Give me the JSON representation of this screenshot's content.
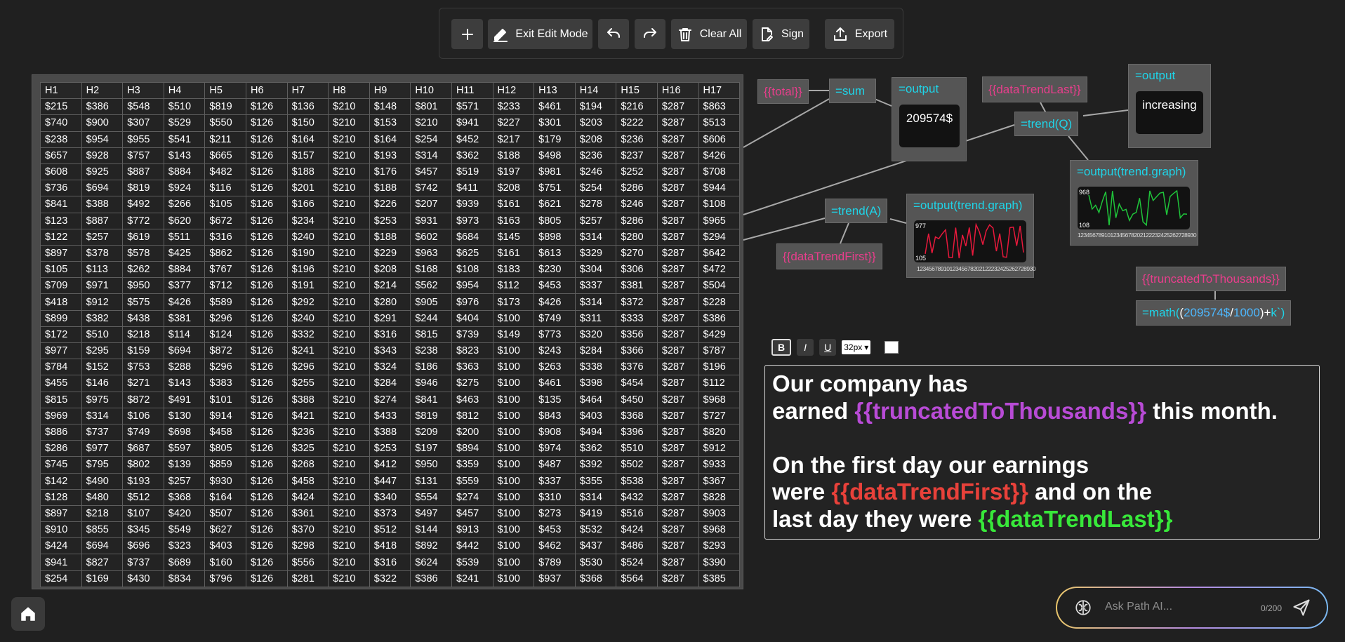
{
  "toolbar": {
    "add_label": "",
    "exit_edit_label": "Exit Edit Mode",
    "clear_all_label": "Clear All",
    "sign_label": "Sign",
    "export_label": "Export"
  },
  "sheet": {
    "headers": [
      "H1",
      "H2",
      "H3",
      "H4",
      "H5",
      "H6",
      "H7",
      "H8",
      "H9",
      "H10",
      "H11",
      "H12",
      "H13",
      "H14",
      "H15",
      "H16",
      "H17"
    ],
    "rows": [
      [
        "$215",
        "$386",
        "$548",
        "$510",
        "$819",
        "$126",
        "$136",
        "$210",
        "$148",
        "$801",
        "$571",
        "$233",
        "$461",
        "$194",
        "$216",
        "$287",
        "$863"
      ],
      [
        "$740",
        "$900",
        "$307",
        "$529",
        "$550",
        "$126",
        "$150",
        "$210",
        "$153",
        "$210",
        "$941",
        "$227",
        "$301",
        "$203",
        "$222",
        "$287",
        "$513"
      ],
      [
        "$238",
        "$954",
        "$955",
        "$541",
        "$211",
        "$126",
        "$164",
        "$210",
        "$164",
        "$254",
        "$452",
        "$217",
        "$179",
        "$208",
        "$236",
        "$287",
        "$606"
      ],
      [
        "$657",
        "$928",
        "$757",
        "$143",
        "$665",
        "$126",
        "$157",
        "$210",
        "$193",
        "$314",
        "$362",
        "$188",
        "$498",
        "$236",
        "$237",
        "$287",
        "$426"
      ],
      [
        "$608",
        "$925",
        "$887",
        "$884",
        "$482",
        "$126",
        "$188",
        "$210",
        "$176",
        "$457",
        "$519",
        "$197",
        "$981",
        "$246",
        "$252",
        "$287",
        "$708"
      ],
      [
        "$736",
        "$694",
        "$819",
        "$924",
        "$116",
        "$126",
        "$201",
        "$210",
        "$188",
        "$742",
        "$411",
        "$208",
        "$751",
        "$254",
        "$286",
        "$287",
        "$944"
      ],
      [
        "$841",
        "$388",
        "$492",
        "$266",
        "$105",
        "$126",
        "$166",
        "$210",
        "$226",
        "$207",
        "$939",
        "$161",
        "$621",
        "$278",
        "$246",
        "$287",
        "$108"
      ],
      [
        "$123",
        "$887",
        "$772",
        "$620",
        "$672",
        "$126",
        "$234",
        "$210",
        "$253",
        "$931",
        "$973",
        "$163",
        "$805",
        "$257",
        "$286",
        "$287",
        "$965"
      ],
      [
        "$122",
        "$257",
        "$619",
        "$511",
        "$316",
        "$126",
        "$240",
        "$210",
        "$188",
        "$602",
        "$684",
        "$145",
        "$898",
        "$314",
        "$280",
        "$287",
        "$294"
      ],
      [
        "$897",
        "$378",
        "$578",
        "$425",
        "$862",
        "$126",
        "$190",
        "$210",
        "$229",
        "$963",
        "$625",
        "$161",
        "$613",
        "$329",
        "$270",
        "$287",
        "$642"
      ],
      [
        "$105",
        "$113",
        "$262",
        "$884",
        "$767",
        "$126",
        "$196",
        "$210",
        "$208",
        "$168",
        "$108",
        "$183",
        "$230",
        "$304",
        "$306",
        "$287",
        "$472"
      ],
      [
        "$709",
        "$971",
        "$950",
        "$377",
        "$712",
        "$126",
        "$191",
        "$210",
        "$214",
        "$562",
        "$954",
        "$112",
        "$453",
        "$337",
        "$381",
        "$287",
        "$504"
      ],
      [
        "$418",
        "$912",
        "$575",
        "$426",
        "$589",
        "$126",
        "$292",
        "$210",
        "$280",
        "$905",
        "$976",
        "$173",
        "$426",
        "$314",
        "$372",
        "$287",
        "$228"
      ],
      [
        "$899",
        "$382",
        "$438",
        "$381",
        "$296",
        "$126",
        "$240",
        "$210",
        "$291",
        "$244",
        "$404",
        "$100",
        "$749",
        "$311",
        "$333",
        "$287",
        "$386"
      ],
      [
        "$172",
        "$510",
        "$218",
        "$114",
        "$124",
        "$126",
        "$332",
        "$210",
        "$316",
        "$815",
        "$739",
        "$149",
        "$773",
        "$320",
        "$356",
        "$287",
        "$429"
      ],
      [
        "$977",
        "$295",
        "$159",
        "$694",
        "$872",
        "$126",
        "$241",
        "$210",
        "$343",
        "$238",
        "$823",
        "$100",
        "$243",
        "$284",
        "$366",
        "$287",
        "$787"
      ],
      [
        "$784",
        "$152",
        "$753",
        "$288",
        "$296",
        "$126",
        "$296",
        "$210",
        "$324",
        "$186",
        "$363",
        "$100",
        "$263",
        "$338",
        "$376",
        "$287",
        "$196"
      ],
      [
        "$455",
        "$146",
        "$271",
        "$143",
        "$383",
        "$126",
        "$255",
        "$210",
        "$284",
        "$946",
        "$275",
        "$100",
        "$461",
        "$398",
        "$454",
        "$287",
        "$112"
      ],
      [
        "$815",
        "$975",
        "$872",
        "$491",
        "$101",
        "$126",
        "$388",
        "$210",
        "$274",
        "$841",
        "$463",
        "$100",
        "$135",
        "$464",
        "$450",
        "$287",
        "$968"
      ],
      [
        "$969",
        "$314",
        "$106",
        "$130",
        "$914",
        "$126",
        "$421",
        "$210",
        "$433",
        "$819",
        "$812",
        "$100",
        "$843",
        "$403",
        "$368",
        "$287",
        "$727"
      ],
      [
        "$886",
        "$737",
        "$749",
        "$698",
        "$458",
        "$126",
        "$236",
        "$210",
        "$388",
        "$209",
        "$200",
        "$100",
        "$908",
        "$494",
        "$396",
        "$287",
        "$820"
      ],
      [
        "$286",
        "$977",
        "$687",
        "$597",
        "$805",
        "$126",
        "$325",
        "$210",
        "$253",
        "$197",
        "$894",
        "$100",
        "$974",
        "$362",
        "$510",
        "$287",
        "$912"
      ],
      [
        "$745",
        "$795",
        "$802",
        "$139",
        "$859",
        "$126",
        "$268",
        "$210",
        "$412",
        "$950",
        "$359",
        "$100",
        "$487",
        "$392",
        "$502",
        "$287",
        "$933"
      ],
      [
        "$142",
        "$490",
        "$193",
        "$257",
        "$930",
        "$126",
        "$458",
        "$210",
        "$447",
        "$131",
        "$559",
        "$100",
        "$337",
        "$355",
        "$538",
        "$287",
        "$367"
      ],
      [
        "$128",
        "$480",
        "$512",
        "$368",
        "$164",
        "$126",
        "$424",
        "$210",
        "$340",
        "$554",
        "$274",
        "$100",
        "$310",
        "$314",
        "$432",
        "$287",
        "$828"
      ],
      [
        "$897",
        "$218",
        "$107",
        "$420",
        "$507",
        "$126",
        "$361",
        "$210",
        "$373",
        "$497",
        "$457",
        "$100",
        "$273",
        "$419",
        "$516",
        "$287",
        "$903"
      ],
      [
        "$910",
        "$855",
        "$345",
        "$549",
        "$627",
        "$126",
        "$370",
        "$210",
        "$512",
        "$144",
        "$913",
        "$100",
        "$453",
        "$532",
        "$424",
        "$287",
        "$968"
      ],
      [
        "$424",
        "$694",
        "$696",
        "$323",
        "$403",
        "$126",
        "$298",
        "$210",
        "$418",
        "$892",
        "$442",
        "$100",
        "$462",
        "$437",
        "$486",
        "$287",
        "$293"
      ],
      [
        "$941",
        "$827",
        "$737",
        "$689",
        "$160",
        "$126",
        "$556",
        "$210",
        "$316",
        "$624",
        "$539",
        "$100",
        "$789",
        "$530",
        "$524",
        "$287",
        "$390"
      ],
      [
        "$254",
        "$169",
        "$430",
        "$834",
        "$796",
        "$126",
        "$281",
        "$210",
        "$322",
        "$386",
        "$241",
        "$100",
        "$937",
        "$368",
        "$564",
        "$287",
        "$385"
      ]
    ]
  },
  "nodes": {
    "total_tpl": "{{total}}",
    "sum_fn": "=sum",
    "output1_title": "=output",
    "output1_value": "209574$",
    "trend_last_tpl": "{{dataTrendLast}}",
    "trend_q_fn": "=trend(Q)",
    "output2_title": "=output",
    "output2_value": "increasing",
    "graph_q_title": "=output(trend.graph)",
    "graph_q_max": "968",
    "graph_q_min": "108",
    "graph_q_xticks": "1234567891012345678202122232425262728930",
    "trend_a_fn": "=trend(A)",
    "trend_first_tpl": "{{dataTrendFirst}}",
    "graph_a_title": "=output(trend.graph)",
    "graph_a_max": "977",
    "graph_a_min": "105",
    "graph_a_xticks": "1234567891012345678202122232425262728930",
    "truncated_tpl": "{{truncatedToThousands}}",
    "math_prefix": "=math(",
    "math_paren": "(",
    "math_value": "209574$",
    "math_slash": "/",
    "math_divisor": "1000",
    "math_close": ")+",
    "math_suffix": "k`)"
  },
  "graph_q_series": [
    863,
    513,
    606,
    426,
    708,
    944,
    108,
    965,
    294,
    642,
    472,
    504,
    228,
    386,
    429,
    787,
    196,
    112,
    968,
    727,
    820,
    912,
    933,
    367,
    828,
    903,
    968,
    293,
    390,
    385
  ],
  "graph_a_series": [
    215,
    740,
    238,
    657,
    608,
    736,
    841,
    123,
    122,
    897,
    105,
    709,
    418,
    899,
    172,
    977,
    784,
    455,
    815,
    969,
    886,
    286,
    745,
    142,
    128,
    897,
    910,
    424,
    941,
    254
  ],
  "editor": {
    "font_size": "32px",
    "bold_label": "B",
    "italic_label": "I",
    "underline_label": "U",
    "l1": "Our company has",
    "l2a": "earned ",
    "l2b": "{{truncatedToThousands}}",
    "l2c": " this month.",
    "l4": "On the first day our earnings",
    "l5a": "were ",
    "l5b": "{{dataTrendFirst}}",
    "l5c": " and on the",
    "l6a": "last day they were ",
    "l6b": "{{dataTrendLast}}"
  },
  "ask": {
    "placeholder": "Ask Path AI...",
    "counter": "0/200"
  },
  "colors": {
    "template_pink": "#e83e8c",
    "function_cyan": "#1fd4e8",
    "graph_red": "#e8193c",
    "graph_green": "#1fc43a",
    "highlight_purple": "#b84bd6",
    "highlight_red": "#e8413a",
    "highlight_green": "#38e83a"
  }
}
